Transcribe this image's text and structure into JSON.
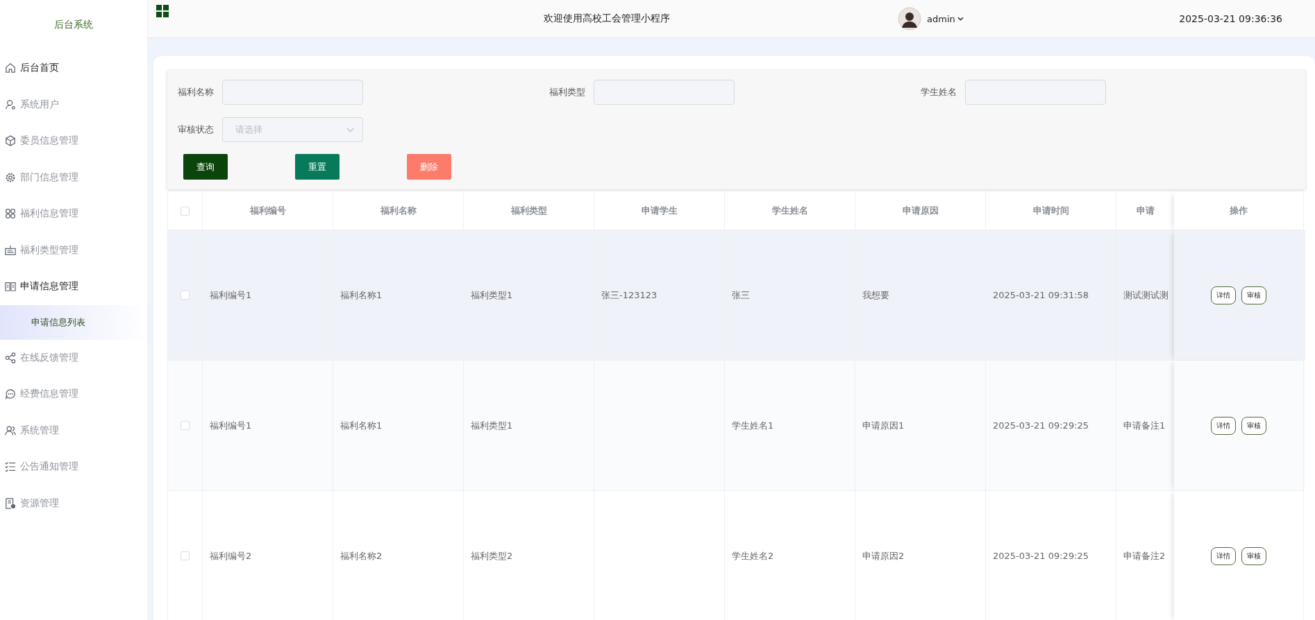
{
  "sidebar": {
    "title": "后台系统",
    "items": [
      {
        "label": "后台首页",
        "highlighted": true
      },
      {
        "label": "系统用户",
        "highlighted": false
      },
      {
        "label": "委员信息管理",
        "highlighted": false
      },
      {
        "label": "部门信息管理",
        "highlighted": false
      },
      {
        "label": "福利信息管理",
        "highlighted": false
      },
      {
        "label": "福利类型管理",
        "highlighted": false
      },
      {
        "label": "申请信息管理",
        "highlighted": true,
        "expanded": true,
        "children": [
          {
            "label": "申请信息列表",
            "selected": true
          }
        ]
      },
      {
        "label": "在线反馈管理",
        "highlighted": false
      },
      {
        "label": "经费信息管理",
        "highlighted": false
      },
      {
        "label": "系统管理",
        "highlighted": false
      },
      {
        "label": "公告通知管理",
        "highlighted": false
      },
      {
        "label": "资源管理",
        "highlighted": false
      }
    ]
  },
  "header": {
    "title": "欢迎使用高校工会管理小程序",
    "user": "admin",
    "datetime": "2025-03-21 09:36:36"
  },
  "filters": [
    {
      "label": "福利名称",
      "kind": "input"
    },
    {
      "label": "福利类型",
      "kind": "input"
    },
    {
      "label": "学生姓名",
      "kind": "input"
    },
    {
      "label": "审核状态",
      "kind": "select",
      "placeholder": "请选择"
    }
  ],
  "buttons": [
    {
      "label": "查询",
      "kind": "search"
    },
    {
      "label": "重置",
      "kind": "reset"
    },
    {
      "label": "删除",
      "kind": "delete"
    }
  ],
  "table": {
    "header_checked": false,
    "columns": [
      "福利编号",
      "福利名称",
      "福利类型",
      "申请学生",
      "学生姓名",
      "申请原因",
      "申请时间",
      "申请",
      "操作"
    ],
    "rows": [
      {
        "checked": false,
        "highlighted": true,
        "cells": [
          "福利编号1",
          "福利名称1",
          "福利类型1",
          "张三-123123",
          "张三",
          "我想要",
          "2025-03-21 09:31:58",
          "测试测试测"
        ],
        "actions": [
          "详情",
          "审核"
        ]
      },
      {
        "checked": false,
        "cells": [
          "福利编号1",
          "福利名称1",
          "福利类型1",
          "",
          "学生姓名1",
          "申请原因1",
          "2025-03-21 09:29:25",
          "申请备注1"
        ],
        "actions": [
          "详情",
          "审核"
        ]
      },
      {
        "checked": false,
        "cells": [
          "福利编号2",
          "福利名称2",
          "福利类型2",
          "",
          "学生姓名2",
          "申请原因2",
          "2025-03-21 09:29:25",
          "申请备注2"
        ],
        "actions": [
          "详情",
          "审核"
        ]
      }
    ]
  }
}
